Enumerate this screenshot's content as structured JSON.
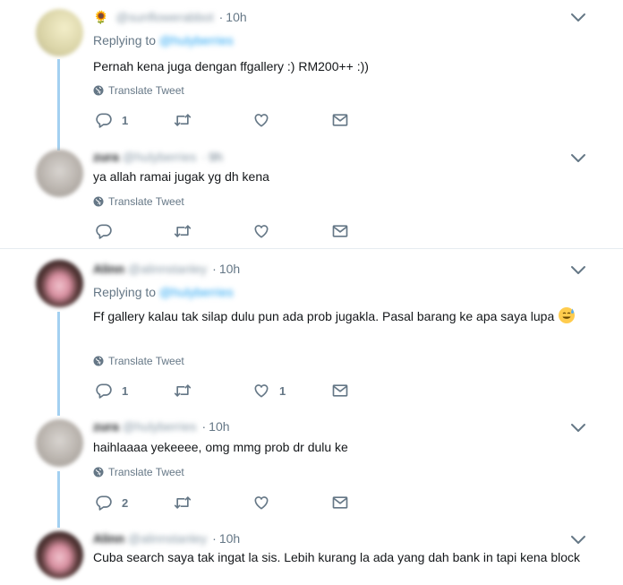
{
  "colors": {
    "link": "#1da1f2",
    "muted": "#657786",
    "thread": "#a3d0f1",
    "divider": "#e6ecf0"
  },
  "tweets": [
    {
      "name": "🌻",
      "handle": "@sunflowerabbot",
      "time": "10h",
      "replying_label": "Replying to",
      "replying_to": "@hulyberries",
      "text": "Pernah kena juga dengan ffgallery :) RM200++ :))",
      "translate": "Translate Tweet",
      "reply_count": "1",
      "like_count": ""
    },
    {
      "name": "zura",
      "handle": "@hulyberries",
      "time": "9h",
      "text": "ya allah ramai jugak yg dh kena",
      "translate": "Translate Tweet",
      "reply_count": "",
      "like_count": ""
    },
    {
      "name": "Alinn",
      "handle": "@alinnstanley",
      "time": "10h",
      "replying_label": "Replying to",
      "replying_to": "@hulyberries",
      "text": "Ff gallery kalau tak silap dulu pun ada prob jugakla. Pasal barang ke apa saya lupa",
      "translate": "Translate Tweet",
      "reply_count": "1",
      "like_count": "1"
    },
    {
      "name": "zura",
      "handle": "@hulyberries",
      "time": "10h",
      "text": "haihlaaaa yekeeee, omg mmg prob dr dulu ke",
      "translate": "Translate Tweet",
      "reply_count": "2",
      "like_count": ""
    },
    {
      "name": "Alinn",
      "handle": "@alinnstanley",
      "time": "10h",
      "text": "Cuba search saya tak ingat la sis. Lebih kurang la ada yang dah bank in tapi kena block"
    }
  ],
  "icons": [
    "reply-icon",
    "retweet-icon",
    "like-icon",
    "dm-icon",
    "globe-icon",
    "chevron-down-icon"
  ]
}
